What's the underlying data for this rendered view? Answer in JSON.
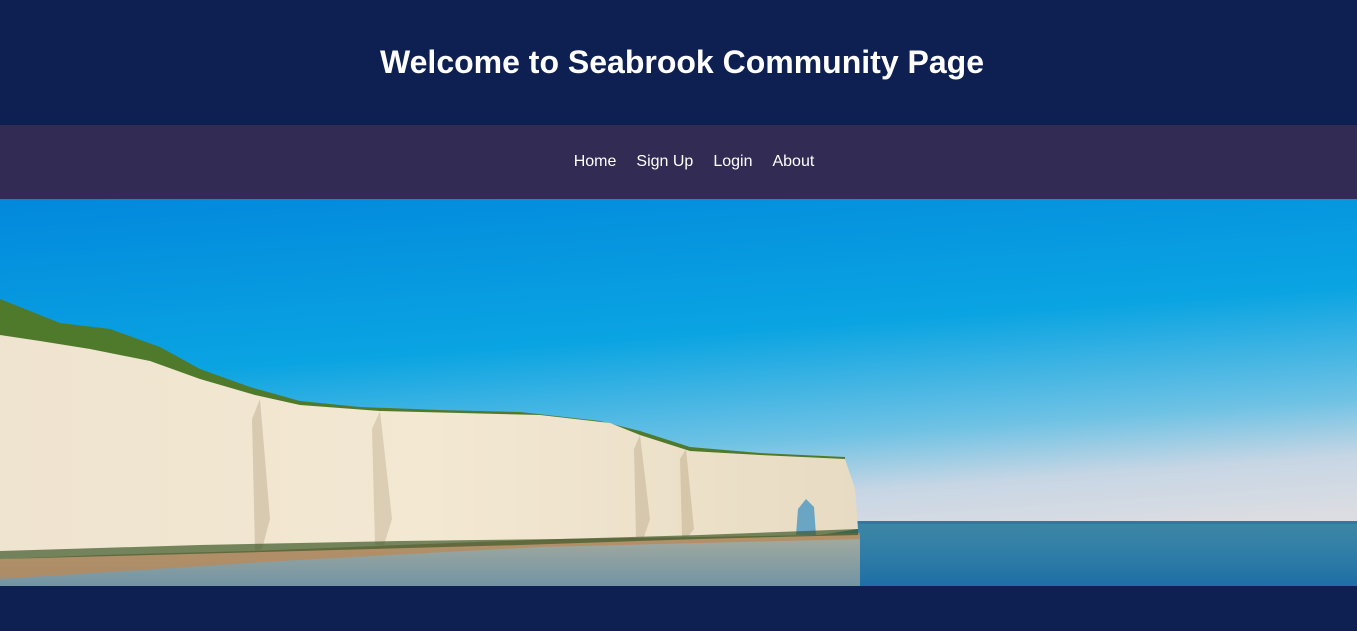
{
  "header": {
    "title": "Welcome to Seabrook Community Page"
  },
  "nav": {
    "items": [
      {
        "label": "Home"
      },
      {
        "label": "Sign Up"
      },
      {
        "label": "Login"
      },
      {
        "label": "About"
      }
    ]
  },
  "hero": {
    "image": "coastal-chalk-cliffs-photo"
  },
  "colors": {
    "header_bg": "#0e1f52",
    "nav_bg": "#322b54",
    "text": "#ffffff"
  }
}
